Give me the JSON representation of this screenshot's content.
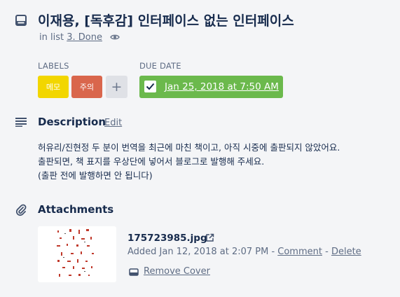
{
  "card": {
    "title": "이재용, [독후감] 인터페이스 없는 인터페이스",
    "in_list_prefix": "in list",
    "list_name": "3. Done"
  },
  "labels": {
    "heading": "LABELS",
    "items": [
      {
        "text": "메모",
        "color": "#f2d600"
      },
      {
        "text": "주의",
        "color": "#d9664c"
      }
    ],
    "add_symbol": "+"
  },
  "due_date": {
    "heading": "DUE DATE",
    "value": "Jan 25, 2018 at 7:50 AM",
    "complete": true,
    "color": "#6bb94c"
  },
  "description": {
    "heading": "Description",
    "edit_label": "Edit",
    "lines": [
      "허유리/진현정 두 분이 번역을 최근에 마친 책이고, 아직 시중에 출판되지 않았어요.",
      "출판되면, 책 표지를 우상단에 넣어서 블로그로 발행해 주세요.",
      "(출판 전에 발행하면 안 됩니다)"
    ]
  },
  "attachments": {
    "heading": "Attachments",
    "items": [
      {
        "filename": "175723985.jpg",
        "added": "Added Jan 12, 2018 at 2:07 PM - ",
        "comment_label": "Comment",
        "separator": " - ",
        "delete_label": "Delete",
        "remove_cover_label": "Remove Cover"
      }
    ]
  },
  "icons": [
    "card-icon",
    "eye-icon",
    "check-icon",
    "description-icon",
    "paperclip-icon",
    "external-link-icon",
    "cover-icon"
  ]
}
